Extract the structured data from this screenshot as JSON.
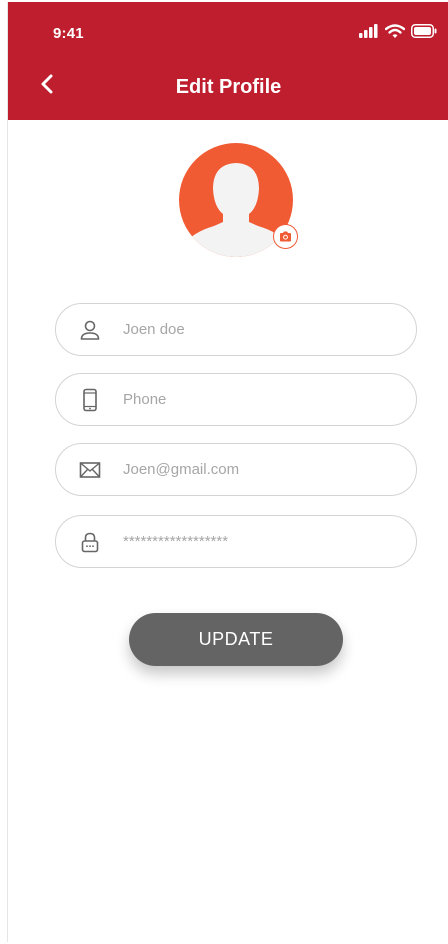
{
  "status_bar": {
    "time": "9:41",
    "icons": [
      "signal-icon",
      "wifi-icon",
      "battery-icon"
    ]
  },
  "header": {
    "title": "Edit Profile",
    "back_icon": "chevron-left-icon"
  },
  "profile": {
    "avatar_icon": "user-silhouette-icon",
    "camera_icon": "camera-icon"
  },
  "form": {
    "name": {
      "placeholder": "Joen doe",
      "icon": "user-icon"
    },
    "phone": {
      "placeholder": "Phone",
      "icon": "phone-icon"
    },
    "email": {
      "placeholder": "Joen@gmail.com",
      "icon": "mail-icon"
    },
    "password": {
      "placeholder": "******************",
      "icon": "lock-icon"
    }
  },
  "actions": {
    "update_label": "UPDATE"
  },
  "colors": {
    "header_bg": "#be1e2d",
    "avatar_bg": "#f15b34",
    "button_bg": "#646464",
    "field_border": "#d4d4d4"
  }
}
